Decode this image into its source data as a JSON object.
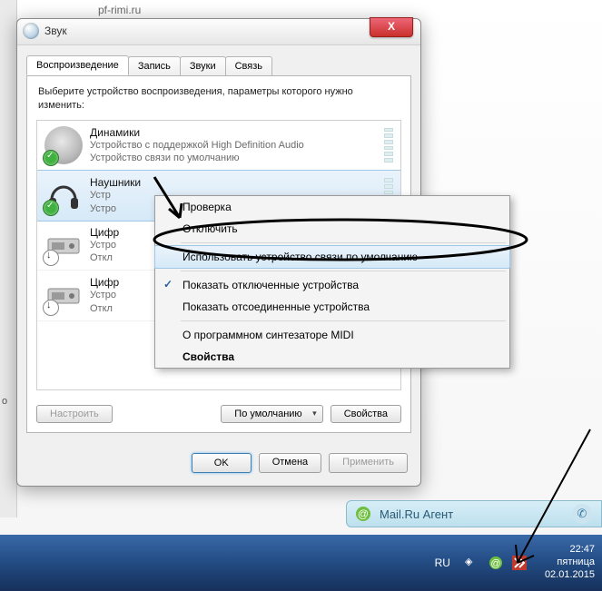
{
  "page_crumb": "pf-rimi.ru",
  "side_label": "о",
  "window": {
    "title": "Звук",
    "close_glyph": "X",
    "tabs": [
      "Воспроизведение",
      "Запись",
      "Звуки",
      "Связь"
    ],
    "instruction": "Выберите устройство воспроизведения, параметры которого нужно изменить:",
    "devices": [
      {
        "name": "Динамики",
        "line1": "Устройство с поддержкой High Definition Audio",
        "line2": "Устройство связи по умолчанию",
        "icon": "speaker",
        "badge": "check"
      },
      {
        "name": "Наушники",
        "line1": "Устр",
        "line2": "Устро",
        "icon": "headphones",
        "badge": "check",
        "selected": true
      },
      {
        "name": "Цифр",
        "line1": "Устро",
        "line2": "Откл",
        "icon": "box",
        "badge": "arrow"
      },
      {
        "name": "Цифр",
        "line1": "Устро",
        "line2": "Откл",
        "icon": "box",
        "badge": "arrow"
      }
    ],
    "btn_configure": "Настроить",
    "btn_default": "По умолчанию",
    "btn_props": "Свойства",
    "btn_ok": "OK",
    "btn_cancel": "Отмена",
    "btn_apply": "Применить"
  },
  "context_menu": {
    "items": [
      {
        "label": "Проверка"
      },
      {
        "label": "Отключить"
      },
      {
        "sep": true
      },
      {
        "label": "Использовать устройство связи по умолчанию",
        "hover": true
      },
      {
        "sep": true
      },
      {
        "label": "Показать отключенные устройства",
        "check": true
      },
      {
        "label": "Показать отсоединенные устройства"
      },
      {
        "sep": true
      },
      {
        "label": "О программном синтезаторе MIDI"
      },
      {
        "label": "Свойства",
        "bold": true
      }
    ]
  },
  "toast": {
    "label": "Mail.Ru Агент"
  },
  "taskbar": {
    "lang": "RU",
    "time": "22:47",
    "day": "пятница",
    "date": "02.01.2015"
  }
}
